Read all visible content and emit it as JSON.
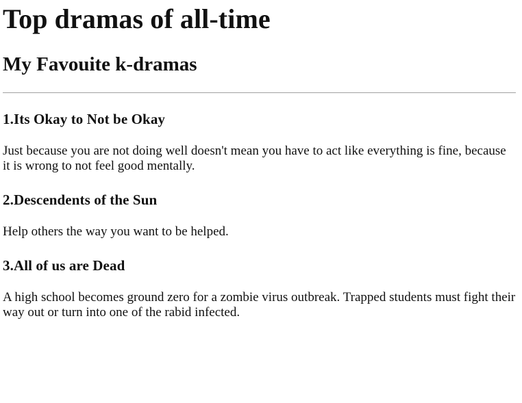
{
  "page": {
    "title": "Top dramas of all-time",
    "subtitle": "My Favouite k-dramas"
  },
  "dramas": [
    {
      "heading": "1.Its Okay to Not be Okay",
      "text": "Just because you are not doing well doesn't mean you have to act like everything is fine, because it is wrong to not feel good mentally."
    },
    {
      "heading": "2.Descendents of the Sun",
      "text": "Help others the way you want to be helped."
    },
    {
      "heading": "3.All of us are Dead",
      "text": "A high school becomes ground zero for a zombie virus outbreak. Trapped students must fight their way out or turn into one of the rabid infected."
    }
  ]
}
